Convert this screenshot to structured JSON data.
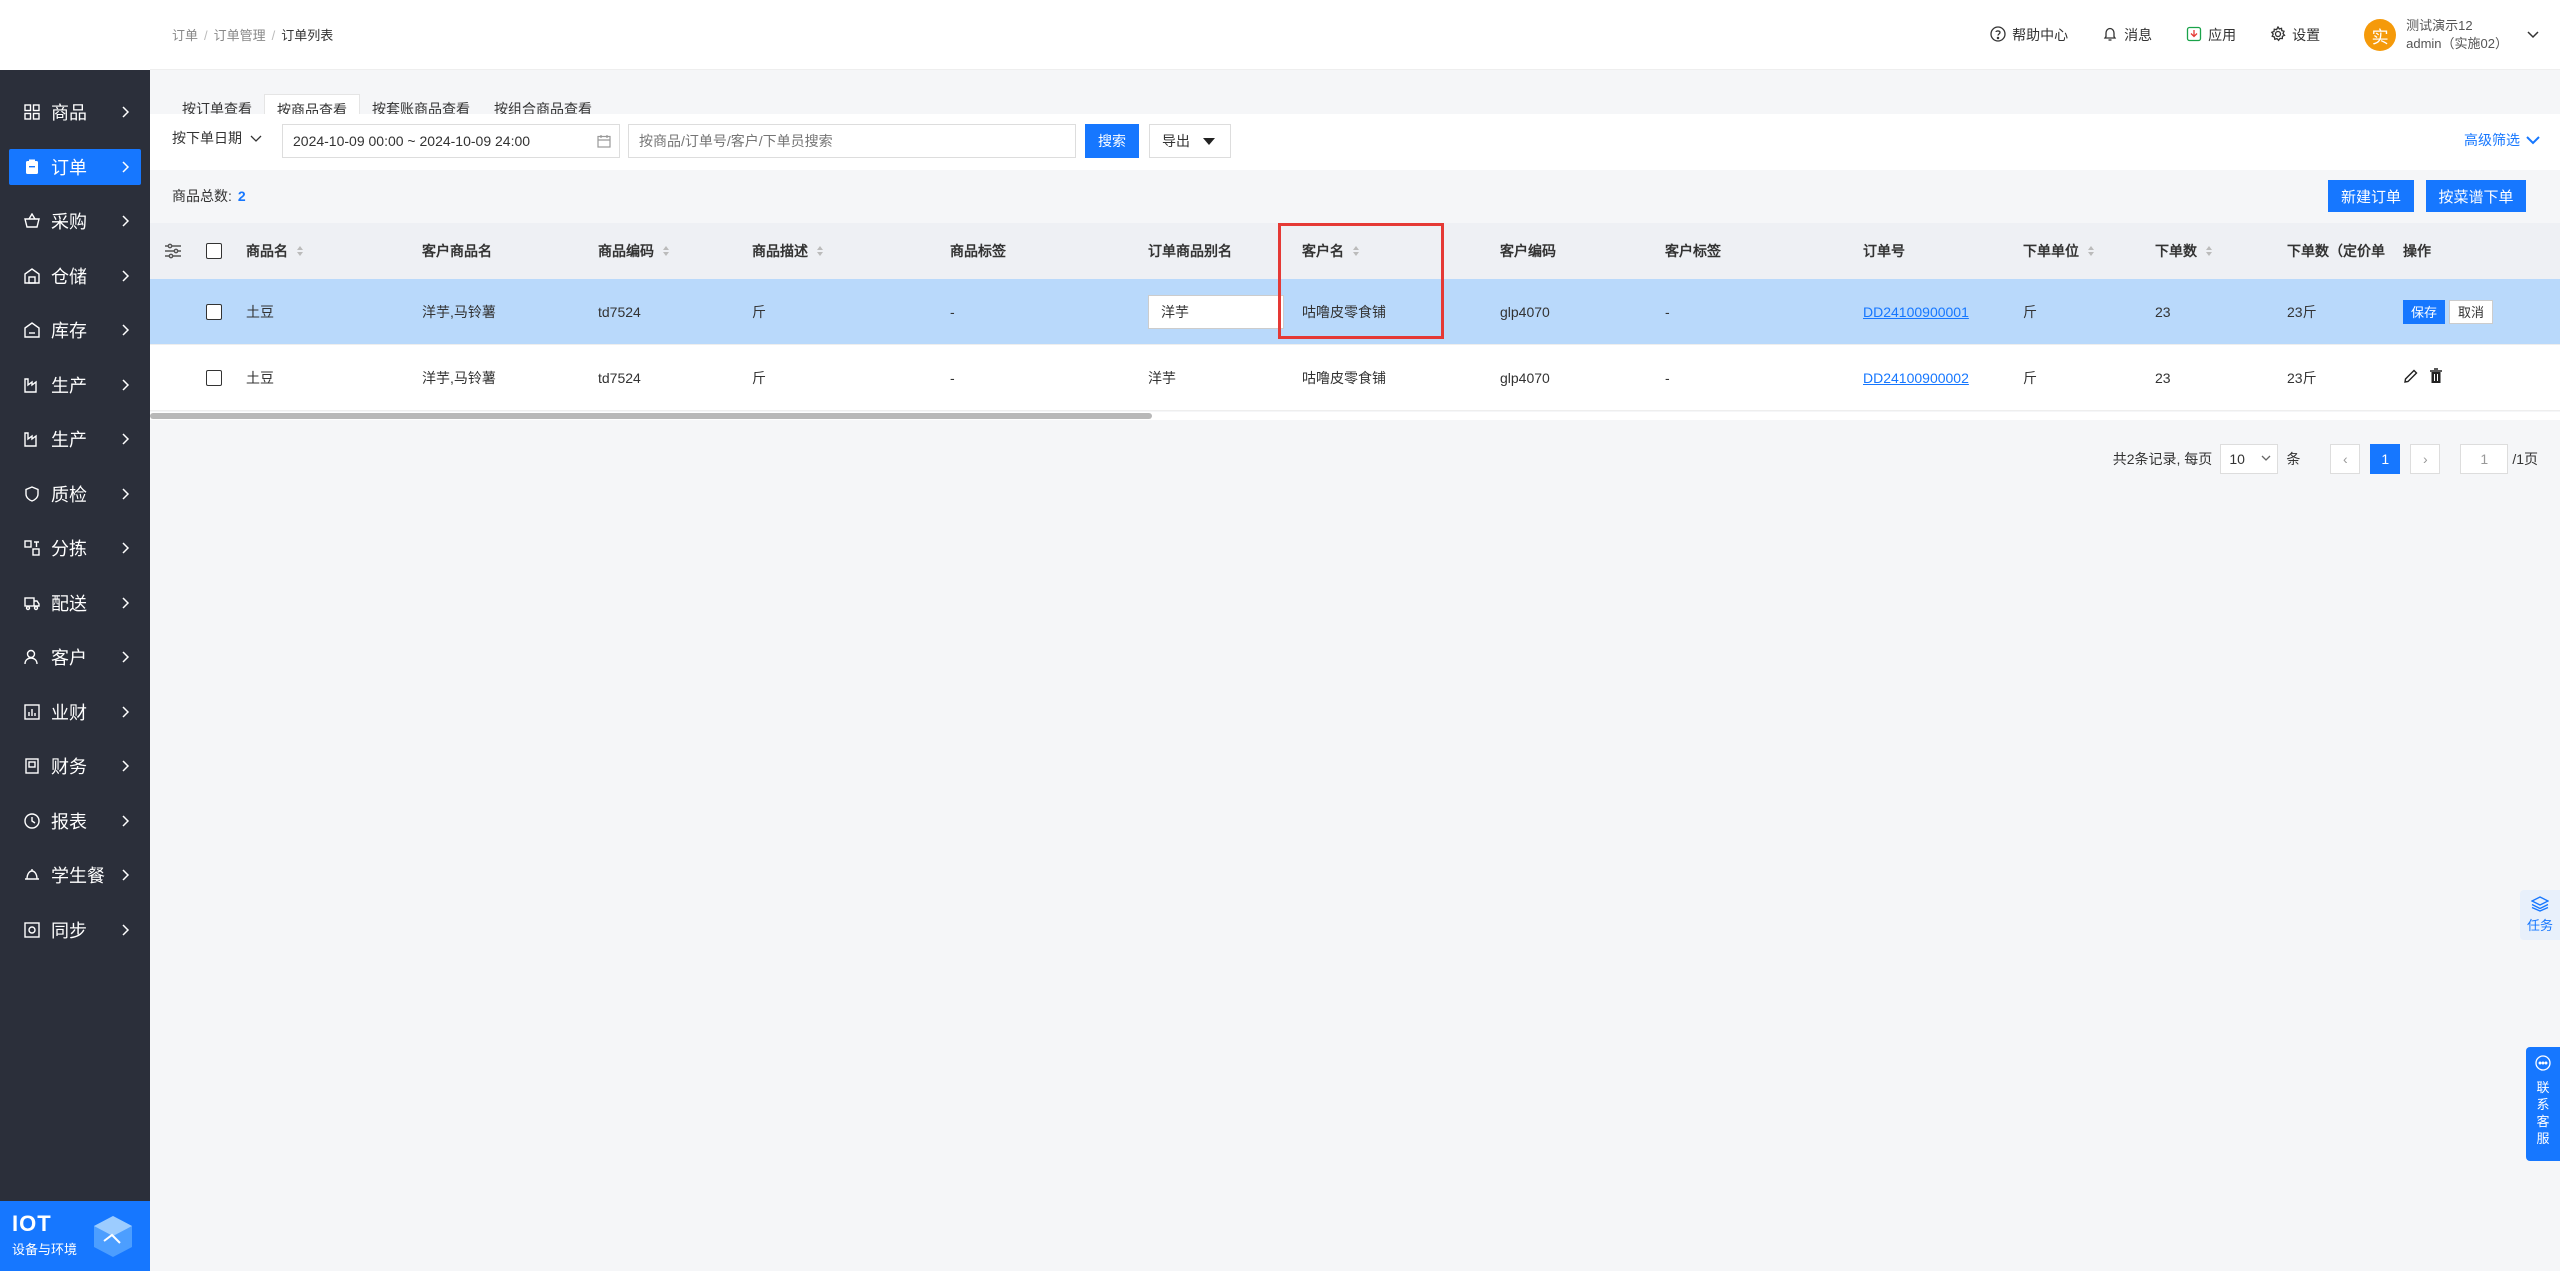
{
  "breadcrumb": [
    "订单",
    "订单管理",
    "订单列表"
  ],
  "topbar": {
    "help": "帮助中心",
    "messages": "消息",
    "apps": "应用",
    "settings": "设置",
    "user_avatar": "实",
    "user_name": "测试演示12",
    "user_role": "admin（实施02）"
  },
  "sidebar": {
    "items": [
      {
        "label": "商品",
        "icon": "grid-icon"
      },
      {
        "label": "订单",
        "icon": "clipboard-icon"
      },
      {
        "label": "采购",
        "icon": "basket-icon"
      },
      {
        "label": "仓储",
        "icon": "warehouse-icon"
      },
      {
        "label": "库存",
        "icon": "stock-icon"
      },
      {
        "label": "生产",
        "icon": "factory-icon"
      },
      {
        "label": "生产",
        "icon": "factory-icon"
      },
      {
        "label": "质检",
        "icon": "shield-icon"
      },
      {
        "label": "分拣",
        "icon": "sort-icon"
      },
      {
        "label": "配送",
        "icon": "truck-icon"
      },
      {
        "label": "客户",
        "icon": "user-icon"
      },
      {
        "label": "业财",
        "icon": "bar-chart-icon"
      },
      {
        "label": "财务",
        "icon": "ledger-icon"
      },
      {
        "label": "报表",
        "icon": "clock-icon"
      },
      {
        "label": "学生餐",
        "icon": "meal-icon"
      },
      {
        "label": "同步",
        "icon": "sync-icon"
      }
    ],
    "active_index": 1,
    "brand": {
      "title": "IOT",
      "subtitle": "设备与环境"
    }
  },
  "tabs": [
    "按订单查看",
    "按商品查看",
    "按套账商品查看",
    "按组合商品查看"
  ],
  "active_tab": 1,
  "filters": {
    "date_type": "按下单日期",
    "date_range": "2024-10-09 00:00 ~ 2024-10-09 24:00",
    "search_placeholder": "按商品/订单号/客户/下单员搜索",
    "search_label": "搜索",
    "export_label": "导出",
    "advanced_label": "高级筛选"
  },
  "summary": {
    "label": "商品总数:",
    "count": "2"
  },
  "actions": {
    "new_order": "新建订单",
    "menu_order": "按菜谱下单"
  },
  "table": {
    "columns": [
      "商品名",
      "客户商品名",
      "商品编码",
      "商品描述",
      "商品标签",
      "订单商品别名",
      "客户名",
      "客户编码",
      "客户标签",
      "订单号",
      "下单单位",
      "下单数",
      "下单数（定价单",
      "操作"
    ],
    "rows": [
      {
        "name": "土豆",
        "customer_name": "洋芋,马铃薯",
        "code": "td7524",
        "desc": "斤",
        "tag": "-",
        "alias": "洋芋",
        "client": "咕噜皮零食铺",
        "client_code": "glp4070",
        "client_tag": "-",
        "order_no": "DD24100900001",
        "unit": "斤",
        "qty": "23",
        "qty_priced": "23斤",
        "save": "保存",
        "cancel": "取消"
      },
      {
        "name": "土豆",
        "customer_name": "洋芋,马铃薯",
        "code": "td7524",
        "desc": "斤",
        "tag": "-",
        "alias": "洋芋",
        "client": "咕噜皮零食铺",
        "client_code": "glp4070",
        "client_tag": "-",
        "order_no": "DD24100900002",
        "unit": "斤",
        "qty": "23",
        "qty_priced": "23斤"
      }
    ]
  },
  "pagination": {
    "total_text": "共2条记录, 每页",
    "page_size": "10",
    "unit": "条",
    "prev": "‹",
    "current": "1",
    "next": "›",
    "jump_value": "1",
    "total_pages": "/1页"
  },
  "floating": {
    "task": "任务",
    "support": [
      "联",
      "系",
      "客",
      "服"
    ]
  }
}
